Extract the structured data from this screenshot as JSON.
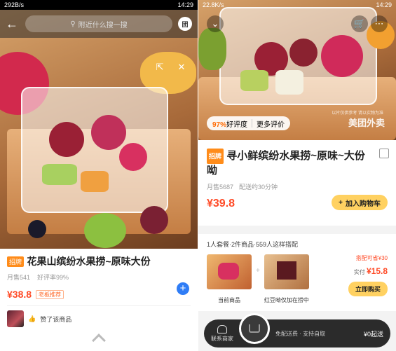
{
  "left": {
    "status": {
      "speed": "292B/s",
      "time": "14:29"
    },
    "header": {
      "search_placeholder": "附近什么搜一搜",
      "store_label": "团"
    },
    "product": {
      "tag": "招牌",
      "title": "花果山缤纷水果捞~原味大份",
      "sales": "月售541",
      "rating": "好评率99%",
      "price": "¥38.8",
      "recommend": "老板推荐"
    },
    "like": {
      "text": "赞了该商品"
    }
  },
  "right": {
    "status": {
      "speed": "22.8K/s",
      "time": "14:29"
    },
    "rating_pill": {
      "score": "97%",
      "label": "好评度",
      "more": "更多评价"
    },
    "watermark": "美团外卖",
    "watermark_note": "以片仅供参考 请以实物为准",
    "product": {
      "tag": "招牌",
      "title": "寻小鲜缤纷水果捞~原味~大份呦",
      "sales": "月售5687",
      "delivery": "配送约30分钟",
      "price": "¥39.8",
      "cart_button": "加入购物车"
    },
    "combo": {
      "title": "1人套餐·2件商品·559人这样搭配",
      "item1": "当前商品",
      "item2": "红豆呦仅加在捞中",
      "save": "搭配可省¥30",
      "actual_label": "实付",
      "actual_price": "¥15.8",
      "buy_button": "立即购买"
    },
    "bottom_bar": {
      "contact": "联系商家",
      "delivery": "免配送费 · 支持自取",
      "min_order": "¥0起送"
    }
  }
}
